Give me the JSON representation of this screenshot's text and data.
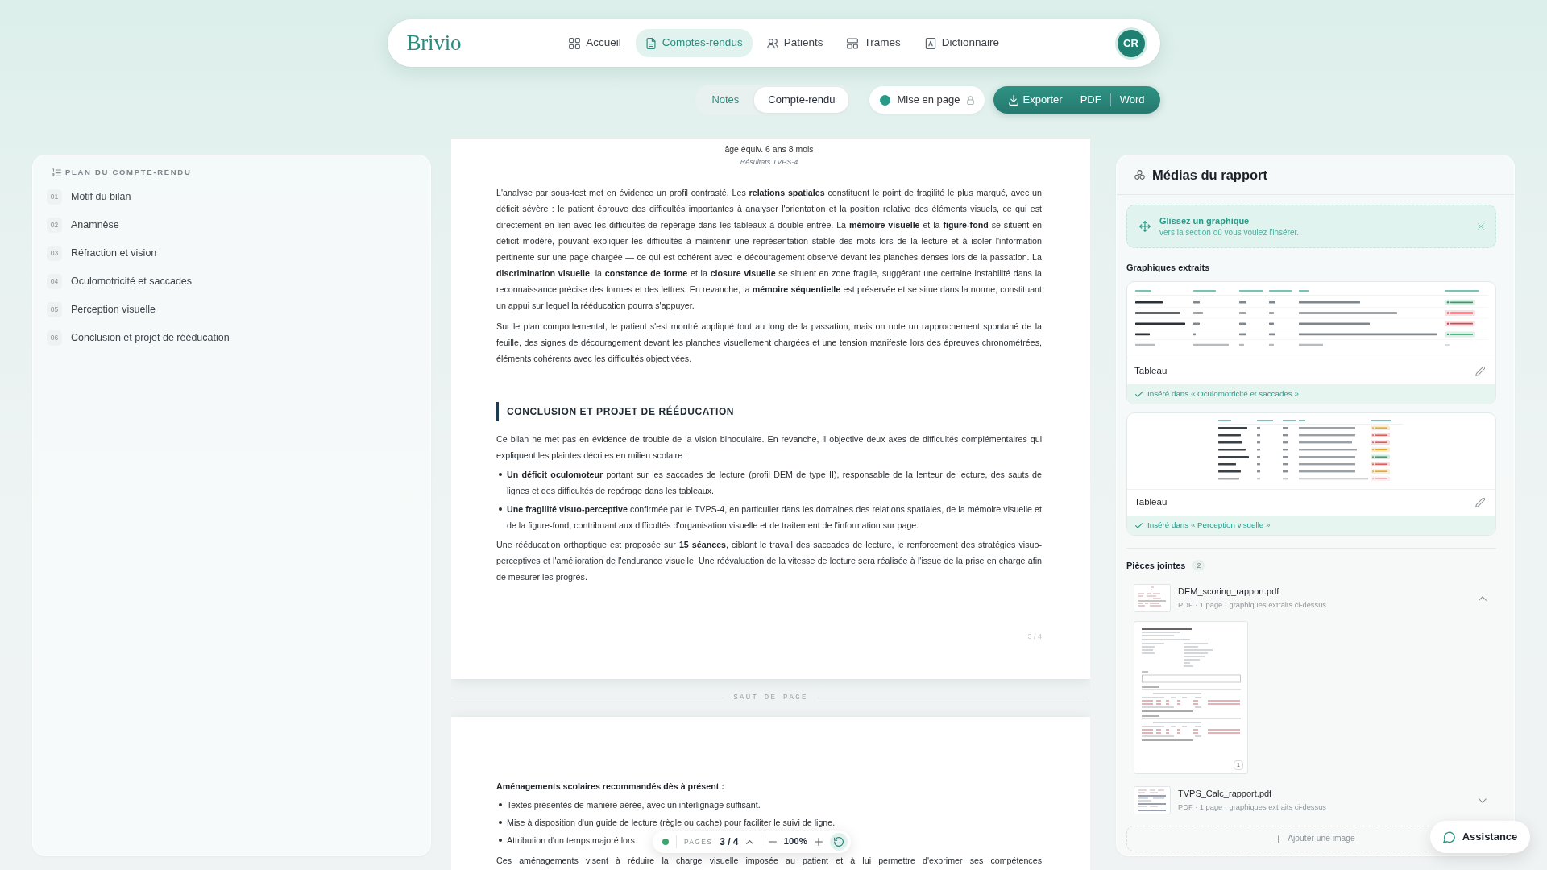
{
  "app": {
    "logo": "Brivio",
    "nav": [
      {
        "kind": "home",
        "label": "Accueil",
        "selected": false
      },
      {
        "kind": "reports",
        "label": "Comptes-rendus",
        "selected": true
      },
      {
        "kind": "patients",
        "label": "Patients",
        "selected": false
      },
      {
        "kind": "templates",
        "label": "Trames",
        "selected": false
      },
      {
        "kind": "dictionary",
        "label": "Dictionnaire",
        "selected": false
      }
    ],
    "avatar": "CR"
  },
  "toolbar": {
    "views": [
      {
        "label": "Notes",
        "selected": false
      },
      {
        "label": "Compte-rendu",
        "selected": true
      }
    ],
    "layout_toggle": {
      "label": "Mise en page",
      "on": true,
      "locked": true
    },
    "export": {
      "label": "Exporter",
      "formats": [
        "PDF",
        "Word"
      ]
    }
  },
  "outline": {
    "title": "PLAN DU COMPTE-RENDU",
    "items": [
      {
        "number": "01",
        "label": "Motif du bilan"
      },
      {
        "number": "02",
        "label": "Anamnèse"
      },
      {
        "number": "03",
        "label": "Réfraction et vision"
      },
      {
        "number": "04",
        "label": "Oculomotricité et saccades"
      },
      {
        "number": "05",
        "label": "Perception visuelle"
      },
      {
        "number": "06",
        "label": "Conclusion et projet de rééducation"
      }
    ]
  },
  "document": {
    "pages": [
      {
        "blocks": [
          {
            "kind": "figure_text",
            "text": "âge équiv. 6 ans 8 mois"
          },
          {
            "kind": "caption",
            "text": "Résultats TVPS-4"
          },
          {
            "kind": "paragraph",
            "continues": false,
            "text": "L'analyse par sous-test met en évidence un profil contrasté. Les **relations spatiales** constituent le point de fragilité le plus marqué, avec un déficit sévère : le patient éprouve des difficultés importantes à analyser l'orientation et la position relative des éléments visuels, ce qui est directement en lien avec les difficultés de repérage dans les tableaux à double entrée. La **mémoire visuelle** et la **figure-fond** se situent en déficit modéré, pouvant expliquer les difficultés à maintenir une représentation stable des mots lors de la lecture et à isoler l'information pertinente sur une page chargée — ce qui est cohérent avec le découragement observé devant les planches denses lors de la passation. La **discrimination visuelle**, la **constance de forme** et la **closure visuelle** se situent en zone fragile, suggérant une certaine instabilité dans la reconnaissance précise des formes et des lettres. En revanche, la **mémoire séquentielle** est préservée et se situe dans la norme, constituant un appui sur lequel la rééducation pourra s'appuyer."
          },
          {
            "kind": "paragraph",
            "continues": false,
            "text": "Sur le plan comportemental, le patient s'est montré appliqué tout au long de la passation, mais on note un rapprochement spontané de la feuille, des signes de découragement devant les planches visuellement chargées et une tension manifeste lors des épreuves chronométrées, éléments cohérents avec les difficultés objectivées."
          },
          {
            "kind": "heading",
            "text": "CONCLUSION ET PROJET DE RÉÉDUCATION"
          },
          {
            "kind": "paragraph",
            "continues": false,
            "text": "Ce bilan ne met pas en évidence de trouble de la vision binoculaire. En revanche, il objective deux axes de difficultés complémentaires qui expliquent les plaintes décrites en milieu scolaire :"
          },
          {
            "kind": "list",
            "items": [
              "**Un déficit oculomoteur** portant sur les saccades de lecture (profil DEM de type II), responsable de la lenteur de lecture, des sauts de lignes et des difficultés de repérage dans les tableaux.",
              "**Une fragilité visuo-perceptive** confirmée par le TVPS-4, en particulier dans les domaines des relations spatiales, de la mémoire visuelle et de la figure-fond, contribuant aux difficultés d'organisation visuelle et de traitement de l'information sur page."
            ]
          },
          {
            "kind": "paragraph",
            "continues": false,
            "text": "Une rééducation orthoptique est proposée sur **15 séances**, ciblant le travail des saccades de lecture, le renforcement des stratégies visuo-perceptives et l'amélioration de l'endurance visuelle. Une réévaluation de la vitesse de lecture sera réalisée à l'issue de la prise en charge afin de mesurer les progrès."
          }
        ],
        "page_number": "3 / 4"
      },
      {
        "blocks": [
          {
            "kind": "lead",
            "text": "Aménagements scolaires recommandés dès à présent :"
          },
          {
            "kind": "list",
            "items": [
              "Textes présentés de manière aérée, avec un interlignage suffisant.",
              "Mise à disposition d'un guide de lecture (règle ou cache) pour faciliter le suivi de ligne.",
              "Attribution d'un temps majoré lors"
            ]
          },
          {
            "kind": "paragraph",
            "continues": true,
            "text": "Ces aménagements visent à réduire la charge visuelle imposée au patient et à lui permettre d'exprimer ses compétences"
          }
        ]
      }
    ],
    "page_break": "SAUT DE PAGE"
  },
  "page_nav": {
    "saved": true,
    "label": "PAGES",
    "current": "3 / 4",
    "zoom": "100%"
  },
  "media_panel": {
    "title": "Médias du rapport",
    "hint": {
      "title": "Glissez un graphique",
      "text": "vers la section où vous voulez l'insérer."
    },
    "extracted": {
      "title": "Graphiques extraits",
      "items": [
        {
          "label": "Tableau",
          "inserted_in": "Inséré dans « Oculomotricité et saccades »",
          "preview": {
            "kind": "wide_table"
          }
        },
        {
          "label": "Tableau",
          "inserted_in": "Inséré dans « Perception visuelle »",
          "preview": {
            "kind": "compact_table"
          }
        }
      ]
    },
    "attachments": {
      "title": "Pièces jointes",
      "count": "2",
      "items": [
        {
          "name": "DEM_scoring_rapport.pdf",
          "meta": "PDF · 1 page · graphiques extraits ci-dessus",
          "expanded": true,
          "preview": {
            "page": "1"
          }
        },
        {
          "name": "TVPS_Calc_rapport.pdf",
          "meta": "PDF · 1 page · graphiques extraits ci-dessus",
          "expanded": false
        }
      ]
    },
    "add_button": "Ajouter une image"
  },
  "assistance": "Assistance"
}
